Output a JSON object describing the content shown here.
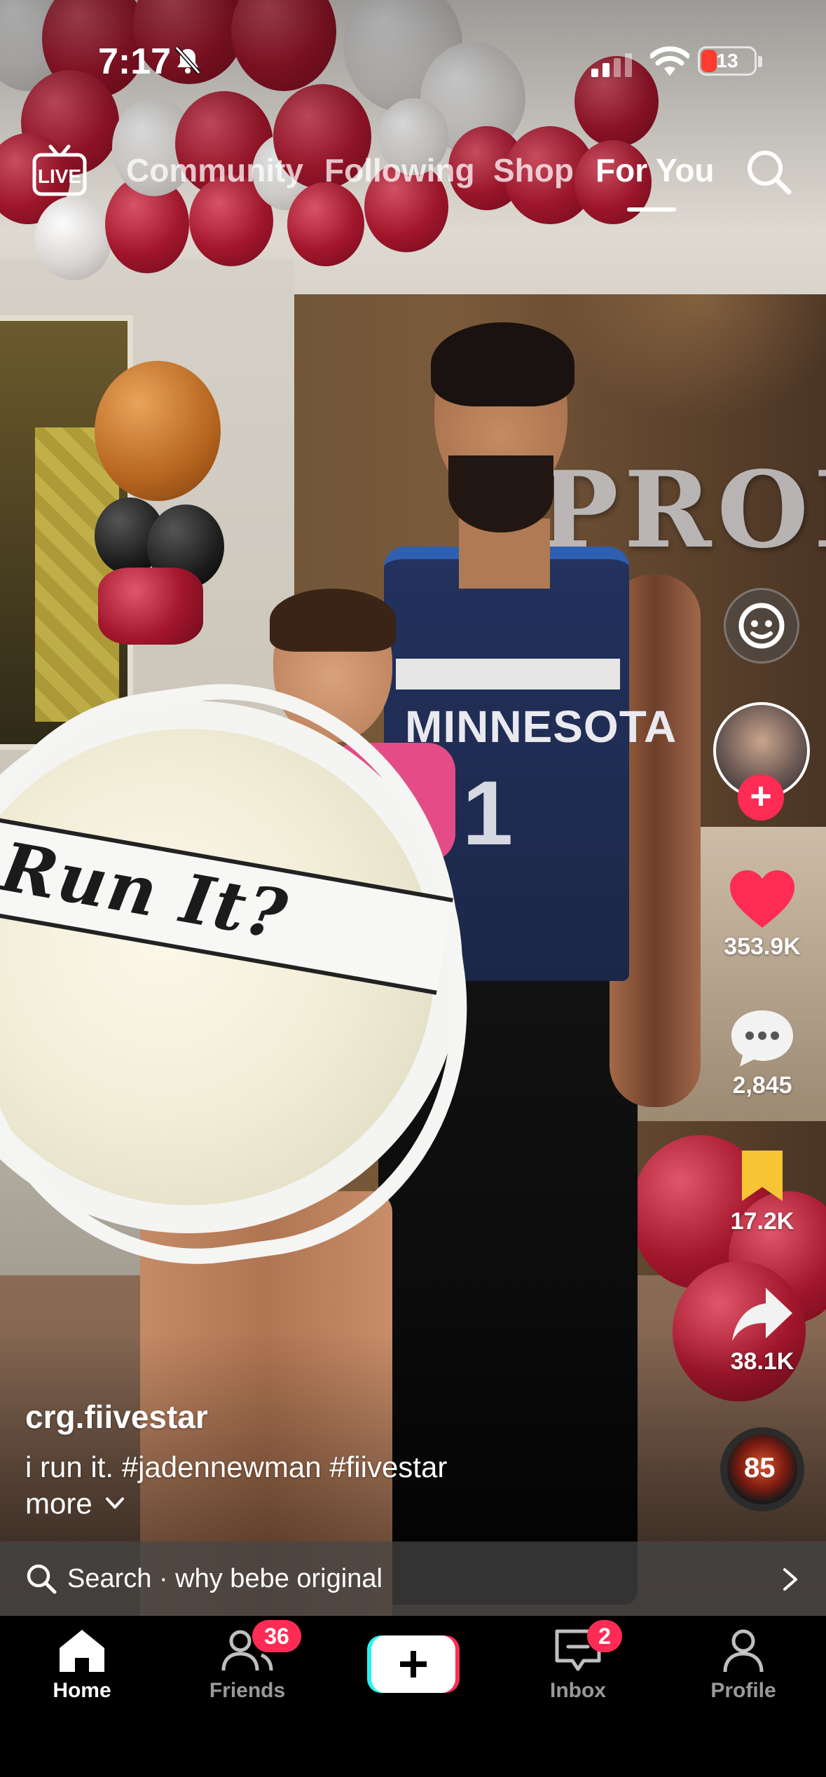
{
  "status_bar": {
    "time": "7:17",
    "battery": "13"
  },
  "top_nav": {
    "live_label": "LIVE",
    "tabs": [
      {
        "label": "Community"
      },
      {
        "label": "Following"
      },
      {
        "label": "Shop"
      },
      {
        "label": "For You"
      }
    ],
    "active_tab": "For You"
  },
  "video_text": {
    "bouquet_ribbon": "Run It?",
    "jersey_name": "MINNESOTA",
    "jersey_number": "1",
    "balloon_letters": "PROM"
  },
  "rail": {
    "likes": "353.9K",
    "comments": "2,845",
    "saves": "17.2K",
    "shares": "38.1K",
    "music_disc_text": "85"
  },
  "caption": {
    "username": "crg.fiivestar",
    "text": "i run it. #jadennewman #fiivestar",
    "more": "more"
  },
  "search_suggestion": {
    "text": "Search · why bebe original"
  },
  "tabbar": {
    "tabs": [
      {
        "label": "Home"
      },
      {
        "label": "Friends"
      },
      {
        "label": "Inbox"
      },
      {
        "label": "Profile"
      }
    ],
    "friends_badge": "36",
    "inbox_badge": "2"
  },
  "colors": {
    "accent_red": "#fe2c55",
    "like_heart": "#fe2c55",
    "bookmark": "#f7c534"
  }
}
